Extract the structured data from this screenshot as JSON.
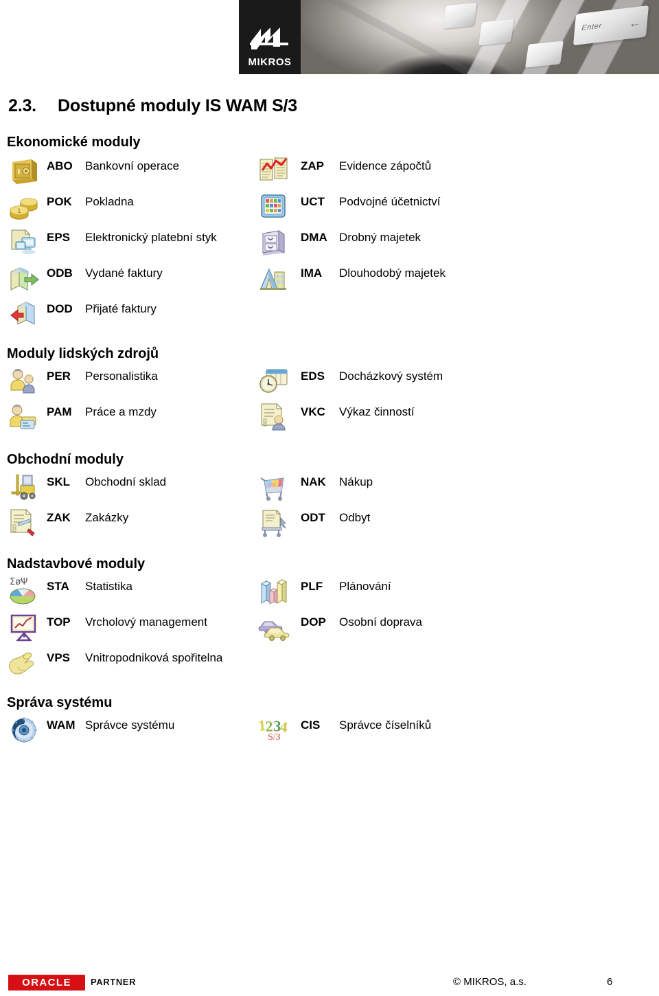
{
  "header": {
    "logo_text": "MIKROS",
    "enter_key_label": "Enter"
  },
  "title": {
    "number": "2.3.",
    "text": "Dostupné moduly IS WAM S/3"
  },
  "sections": [
    {
      "heading": "Ekonomické moduly",
      "left_modules": [
        {
          "icon": "safe-icon",
          "code": "ABO",
          "name": "Bankovní operace"
        },
        {
          "icon": "coins-icon",
          "code": "POK",
          "name": "Pokladna"
        },
        {
          "icon": "document-monitor-icon",
          "code": "EPS",
          "name": "Elektronický platební styk"
        },
        {
          "icon": "books-out-icon",
          "code": "ODB",
          "name": "Vydané faktury"
        },
        {
          "icon": "books-in-icon",
          "code": "DOD",
          "name": "Přijaté faktury"
        }
      ],
      "right_modules": [
        {
          "icon": "documents-chart-icon",
          "code": "ZAP",
          "name": "Evidence zápočtů"
        },
        {
          "icon": "abacus-icon",
          "code": "UCT",
          "name": "Podvojné účetnictví"
        },
        {
          "icon": "file-cabinet-icon",
          "code": "DMA",
          "name": "Drobný majetek"
        },
        {
          "icon": "building-icon",
          "code": "IMA",
          "name": "Dlouhodobý majetek"
        }
      ]
    },
    {
      "heading": "Moduly lidských zdrojů",
      "left_modules": [
        {
          "icon": "two-people-icon",
          "code": "PER",
          "name": "Personalistika"
        },
        {
          "icon": "person-payroll-icon",
          "code": "PAM",
          "name": "Práce a mzdy"
        }
      ],
      "right_modules": [
        {
          "icon": "clock-calendar-icon",
          "code": "EDS",
          "name": "Docházkový systém"
        },
        {
          "icon": "report-person-icon",
          "code": "VKC",
          "name": "Výkaz činností"
        }
      ]
    },
    {
      "heading": "Obchodní moduly",
      "left_modules": [
        {
          "icon": "forklift-icon",
          "code": "SKL",
          "name": "Obchodní sklad"
        },
        {
          "icon": "document-pen-icon",
          "code": "ZAK",
          "name": "Zakázky"
        }
      ],
      "right_modules": [
        {
          "icon": "shopping-cart-icon",
          "code": "NAK",
          "name": "Nákup"
        },
        {
          "icon": "dispatch-cart-icon",
          "code": "ODT",
          "name": "Odbyt"
        }
      ]
    },
    {
      "heading": "Nadstavbové moduly",
      "left_modules": [
        {
          "icon": "pie-chart-stats-icon",
          "code": "STA",
          "name": "Statistika"
        },
        {
          "icon": "presentation-icon",
          "code": "TOP",
          "name": "Vrcholový management"
        },
        {
          "icon": "hand-coin-icon",
          "code": "VPS",
          "name": "Vnitropodniková spořitelna"
        }
      ],
      "right_modules": [
        {
          "icon": "bar-chart-3d-icon",
          "code": "PLF",
          "name": "Plánování"
        },
        {
          "icon": "cars-icon",
          "code": "DOP",
          "name": "Osobní doprava"
        }
      ]
    },
    {
      "heading": "Správa systému",
      "left_modules": [
        {
          "icon": "gear-icon",
          "code": "WAM",
          "name": "Správce systému"
        }
      ],
      "right_modules": [
        {
          "icon": "numbers-1234-icon",
          "code": "CIS",
          "name": "Správce číselníků"
        }
      ]
    }
  ],
  "footer": {
    "oracle_label": "ORACLE",
    "partner_label": "PARTNER",
    "copyright": "© MIKROS, a.s.",
    "page_number": "6"
  },
  "colors": {
    "oracle_red": "#d60f14",
    "gold": "#e8c84a",
    "blue": "#8fb8e0",
    "text": "#000000"
  }
}
